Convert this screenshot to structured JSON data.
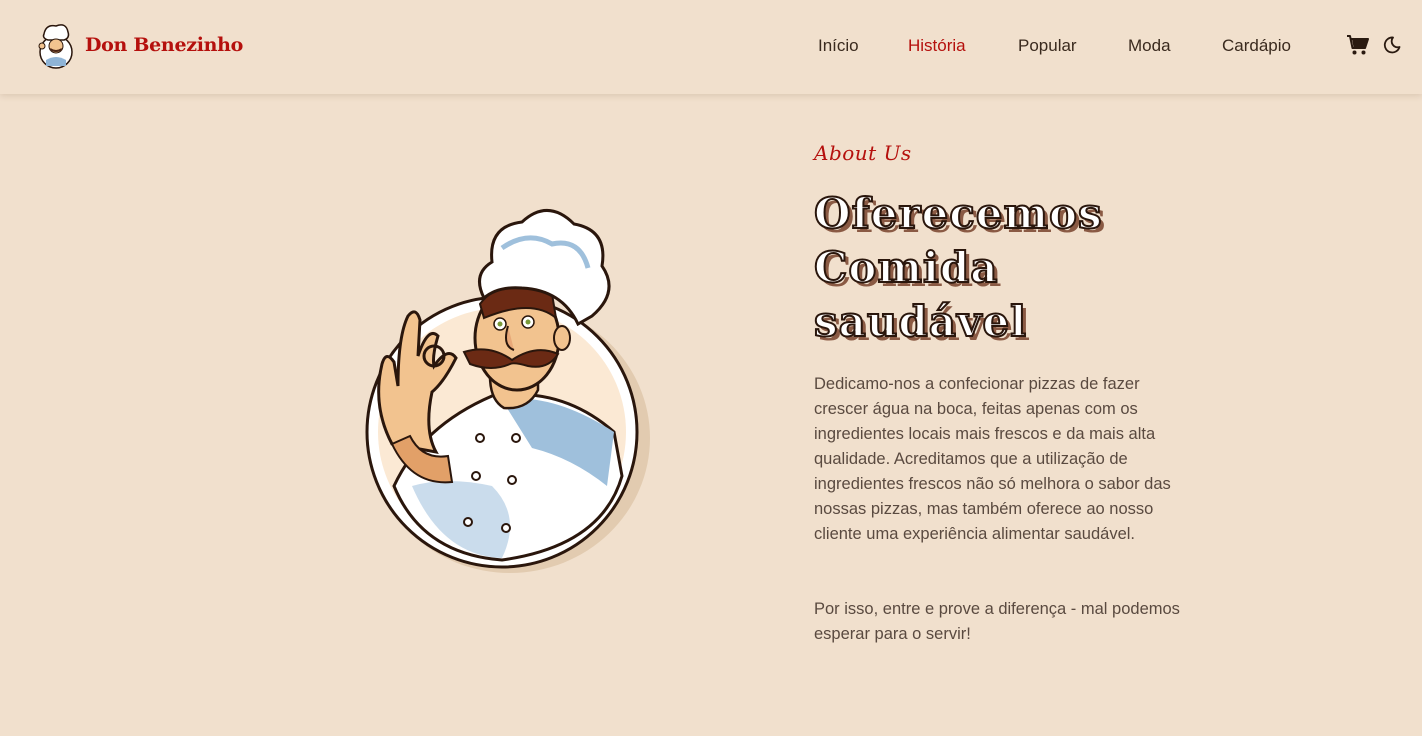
{
  "header": {
    "brand": "Don Benezinho",
    "nav": [
      {
        "label": "Início",
        "active": false
      },
      {
        "label": "História",
        "active": true
      },
      {
        "label": "Popular",
        "active": false
      },
      {
        "label": "Moda",
        "active": false
      },
      {
        "label": "Cardápio",
        "active": false
      }
    ],
    "icons": {
      "cart": "cart-icon",
      "theme": "moon-icon"
    }
  },
  "about": {
    "subtitle": "About Us",
    "title_lines": [
      "Oferecemos",
      "Comida",
      "saudável"
    ],
    "paragraph1": "Dedicamo-nos a confecionar pizzas de fazer crescer água na boca, feitas apenas com os ingredientes locais mais frescos e da mais alta qualidade. Acreditamos que a utilização de ingredientes frescos não só melhora o sabor das nossas pizzas, mas também oferece ao nosso cliente uma experiência alimentar saudável.",
    "paragraph2": "Por isso, entre e prove a diferença - mal podemos esperar para o servir!"
  },
  "colors": {
    "background": "#f1e0cd",
    "accent": "#b5100d",
    "text": "#3a2a1e",
    "body_text": "#5a4a40"
  }
}
